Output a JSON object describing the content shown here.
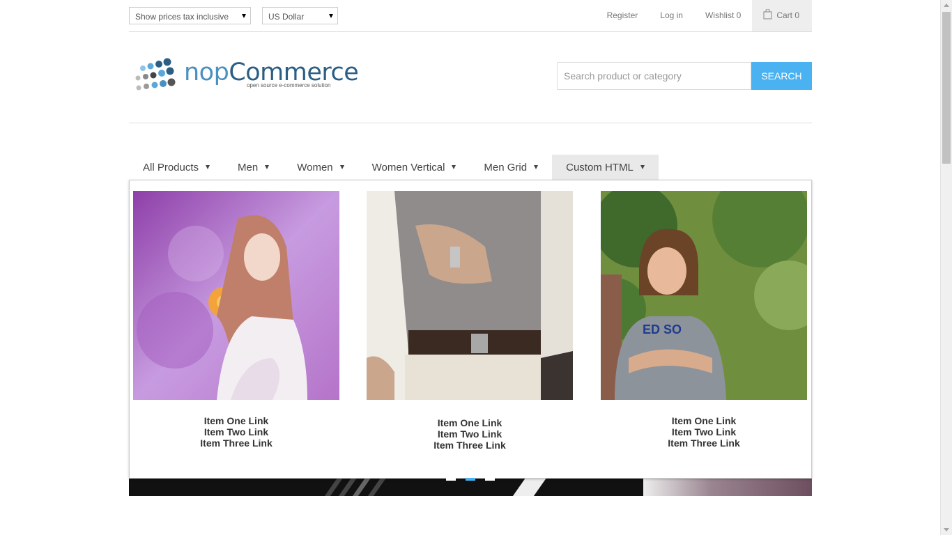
{
  "header": {
    "tax_select": "Show prices tax inclusive",
    "currency_select": "US Dollar",
    "register": "Register",
    "login": "Log in",
    "wishlist": "Wishlist 0",
    "cart": "Cart 0"
  },
  "logo": {
    "name_part1": "nop",
    "name_part2": "Commerce",
    "tagline": "open source e-commerce solution"
  },
  "search": {
    "placeholder": "Search product or category",
    "button": "Search"
  },
  "nav": {
    "items": [
      {
        "label": "All Products"
      },
      {
        "label": "Men"
      },
      {
        "label": "Women"
      },
      {
        "label": "Women Vertical"
      },
      {
        "label": "Men Grid"
      },
      {
        "label": "Custom HTML",
        "active": true
      }
    ]
  },
  "dropdown": {
    "columns": [
      {
        "image": "woman-photo",
        "links": [
          "Item One Link",
          "Item Two Link",
          "Item Three Link"
        ]
      },
      {
        "image": "man-watch-photo",
        "links": [
          "Item One Link",
          "Item Two Link",
          "Item Three Link"
        ]
      },
      {
        "image": "boy-photo",
        "links": [
          "Item One Link",
          "Item Two Link",
          "Item Three Link"
        ]
      }
    ]
  },
  "slider": {
    "active_dot": 2,
    "dot_count": 3
  },
  "colors": {
    "accent": "#4ab2f1",
    "logo_blue": "#4a90c2",
    "nav_active_bg": "#e9e9e9"
  }
}
